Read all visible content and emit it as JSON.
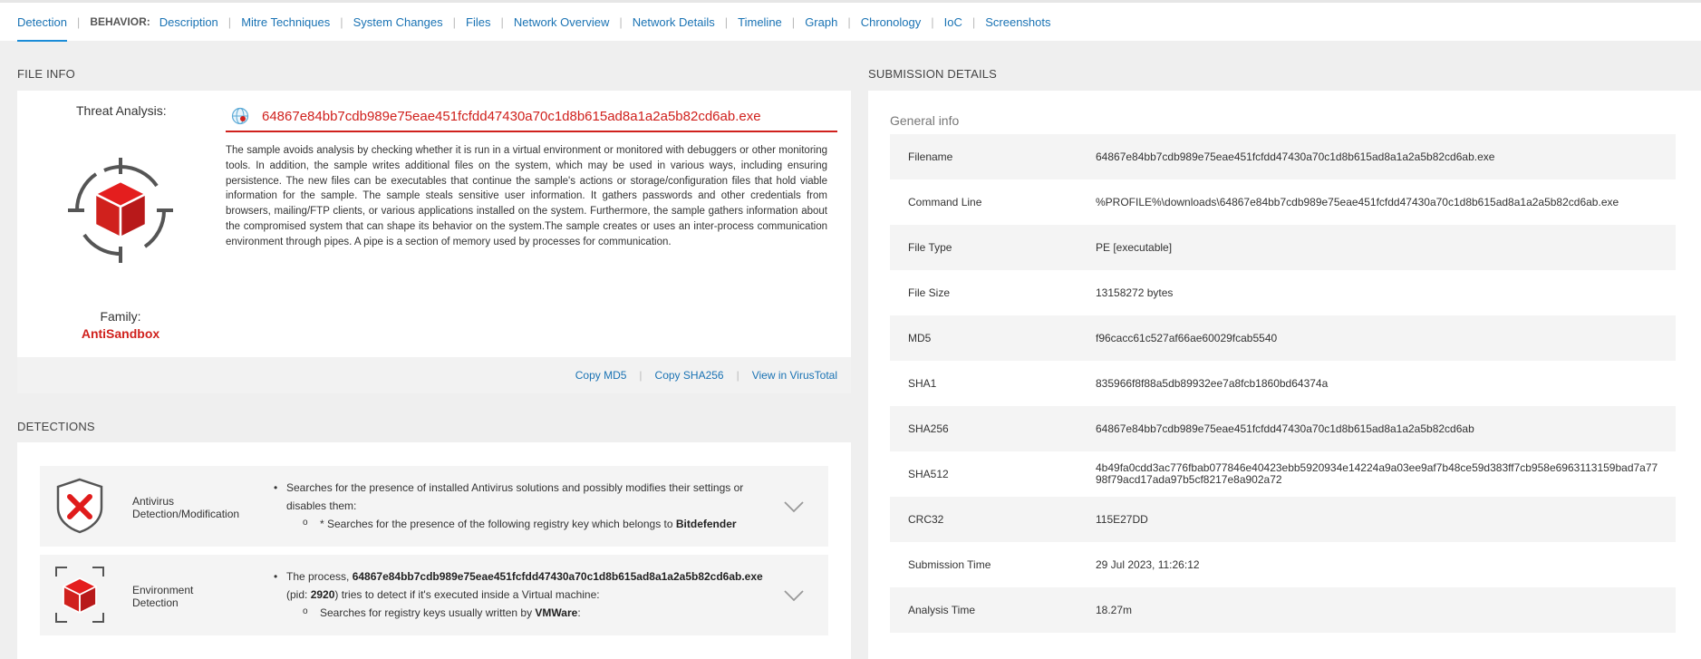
{
  "nav": {
    "detection": "Detection",
    "behavior_label": "BEHAVIOR:",
    "items": [
      "Description",
      "Mitre Techniques",
      "System Changes",
      "Files",
      "Network Overview",
      "Network Details",
      "Timeline",
      "Graph",
      "Chronology",
      "IoC",
      "Screenshots"
    ]
  },
  "file_info": {
    "section_title": "FILE INFO",
    "threat_label": "Threat Analysis:",
    "filename": "64867e84bb7cdb989e75eae451fcfdd47430a70c1d8b615ad8a1a2a5b82cd6ab.exe",
    "description": "The sample avoids analysis by checking whether it is run in a virtual environment or monitored with debuggers or other monitoring tools. In addition, the sample writes additional files on the system, which may be used in various ways, including ensuring persistence. The new files can be executables that continue the sample's actions or storage/configuration files that hold viable information for the sample. The sample steals sensitive user information. It gathers passwords and other credentials from browsers, mailing/FTP clients, or various applications installed on the system. Furthermore, the sample gathers information about the compromised system that can shape its behavior on the system.The sample creates or uses an inter-process communication environment through pipes. A pipe is a section of memory used by processes for communication.",
    "family_label": "Family:",
    "family_value": "AntiSandbox",
    "actions": {
      "copy_md5": "Copy MD5",
      "copy_sha256": "Copy SHA256",
      "virustotal": "View in VirusTotal"
    },
    "colors": {
      "accent_red": "#d0211d",
      "link_blue": "#1a73b4"
    }
  },
  "detections": {
    "section_title": "DETECTIONS",
    "items": [
      {
        "icon": "shield-x-icon",
        "name_line1": "Antivirus",
        "name_line2": "Detection/Modification",
        "bullet": "Searches for the presence of installed Antivirus solutions and possibly modifies their settings or disables them:",
        "sub_prefix": "* Searches for the presence of the following registry key which belongs to ",
        "sub_bold": "Bitdefender"
      },
      {
        "icon": "cube-target-icon",
        "name_line1": "Environment",
        "name_line2": "Detection",
        "bullet_prefix": "The process, ",
        "bullet_bold": "64867e84bb7cdb989e75eae451fcfdd47430a70c1d8b615ad8a1a2a5b82cd6ab.exe",
        "bullet_pid_prefix": "(pid: ",
        "bullet_pid": "2920",
        "bullet_suffix": ") tries to detect if it's executed inside a Virtual machine:",
        "sub_prefix": "Searches for registry keys usually written by ",
        "sub_bold": "VMWare",
        "sub_suffix": ":"
      }
    ]
  },
  "submission": {
    "section_title": "SUBMISSION DETAILS",
    "general_info": "General info",
    "rows": [
      {
        "key": "Filename",
        "value": "64867e84bb7cdb989e75eae451fcfdd47430a70c1d8b615ad8a1a2a5b82cd6ab.exe"
      },
      {
        "key": "Command Line",
        "value": "%PROFILE%\\downloads\\64867e84bb7cdb989e75eae451fcfdd47430a70c1d8b615ad8a1a2a5b82cd6ab.exe"
      },
      {
        "key": "File Type",
        "value": "PE [executable]"
      },
      {
        "key": "File Size",
        "value": "13158272 bytes"
      },
      {
        "key": "MD5",
        "value": "f96cacc61c527af66ae60029fcab5540"
      },
      {
        "key": "SHA1",
        "value": "835966f8f88a5db89932ee7a8fcb1860bd64374a"
      },
      {
        "key": "SHA256",
        "value": "64867e84bb7cdb989e75eae451fcfdd47430a70c1d8b615ad8a1a2a5b82cd6ab"
      },
      {
        "key": "SHA512",
        "value": "4b49fa0cdd3ac776fbab077846e40423ebb5920934e14224a9a03ee9af7b48ce59d383ff7cb958e6963113159bad7a7798f79acd17ada97b5cf8217e8a902a72"
      },
      {
        "key": "CRC32",
        "value": "115E27DD"
      },
      {
        "key": "Submission Time",
        "value": "29 Jul 2023, 11:26:12"
      },
      {
        "key": "Analysis Time",
        "value": "18.27m"
      }
    ]
  }
}
